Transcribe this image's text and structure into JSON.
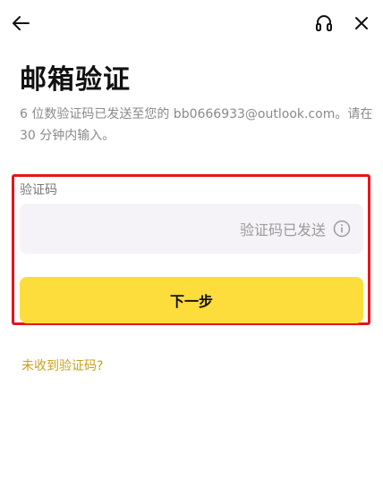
{
  "header": {
    "back_icon": "arrow-left-icon",
    "support_icon": "headset-icon",
    "close_icon": "close-icon"
  },
  "page": {
    "title": "邮箱验证",
    "description": "6 位数验证码已发送至您的 bb0666933@outlook.com。请在 30 分钟内输入。"
  },
  "form": {
    "code_label": "验证码",
    "code_value": "",
    "sent_status": "验证码已发送",
    "info_icon": "info-icon",
    "next_button": "下一步"
  },
  "footer": {
    "resend_link": "未收到验证码?"
  },
  "colors": {
    "accent": "#fcdd3c",
    "link": "#c9a11c",
    "highlight_border": "#e8141b"
  }
}
